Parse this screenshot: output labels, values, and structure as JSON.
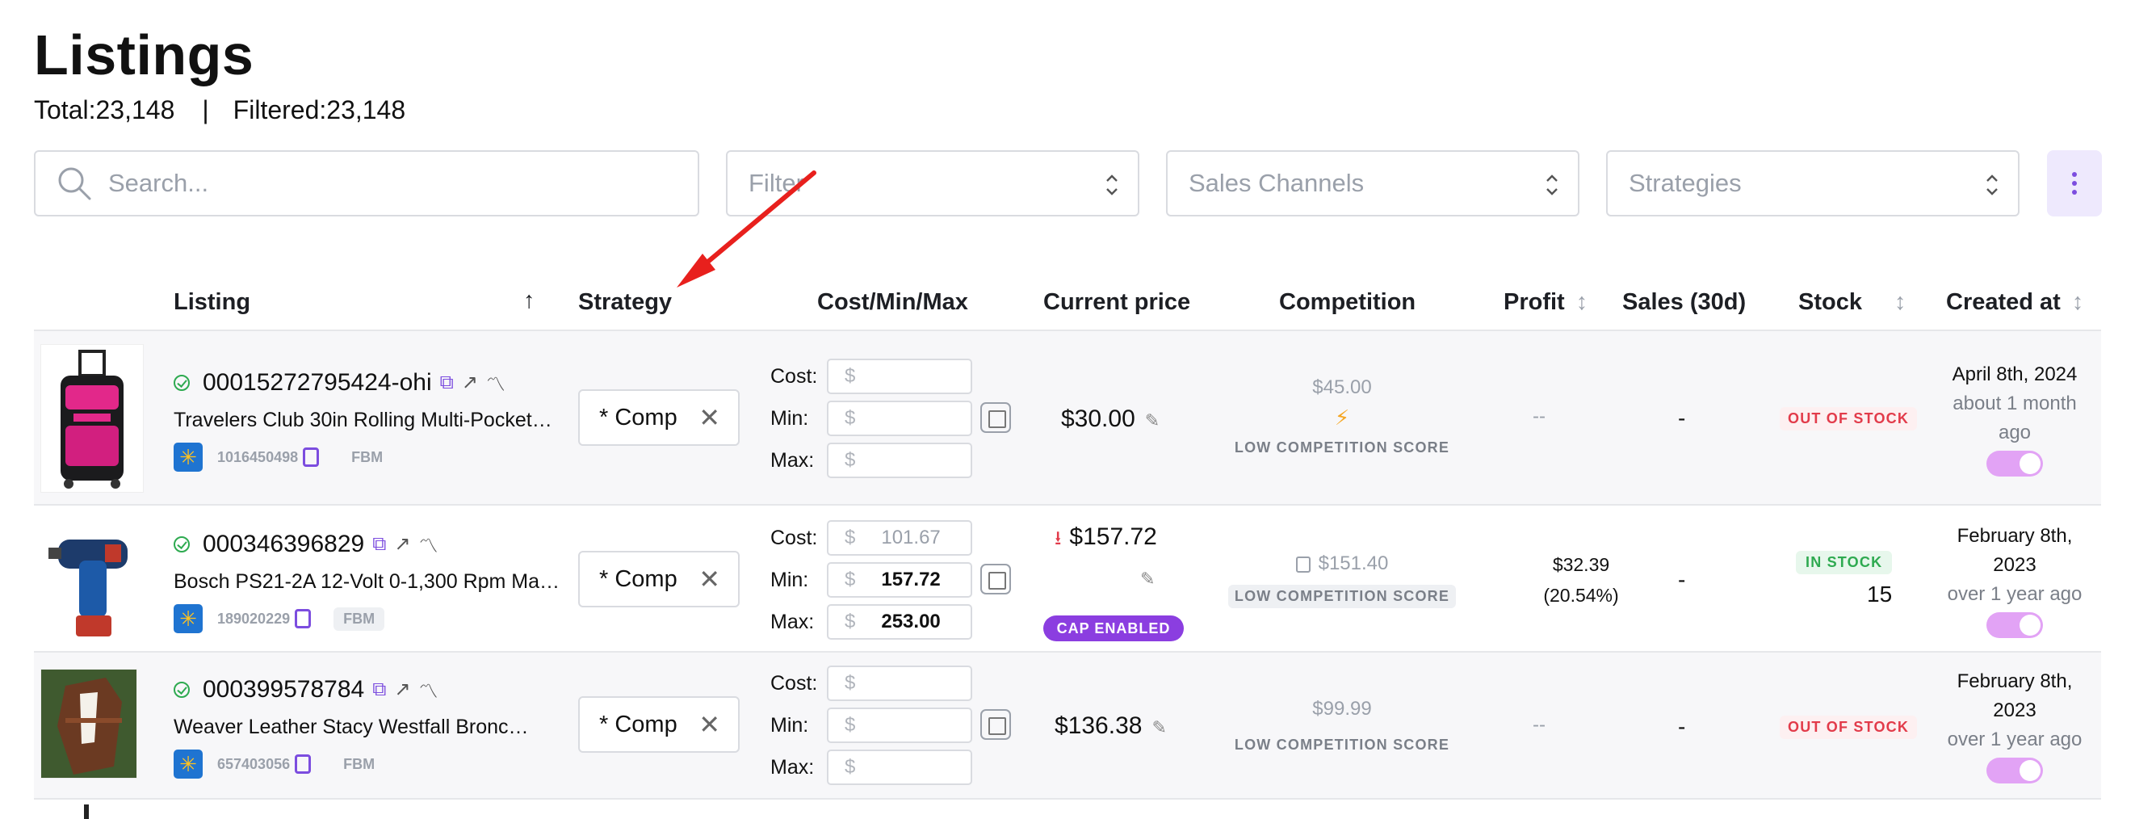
{
  "page": {
    "title": "Listings",
    "total": "Total:23,148",
    "separator": "|",
    "filtered": "Filtered:23,148"
  },
  "toolbar": {
    "search_placeholder": "Search...",
    "filter_placeholder": "Filter",
    "channels_placeholder": "Sales Channels",
    "strategies_placeholder": "Strategies"
  },
  "columns": {
    "listing": "Listing",
    "strategy": "Strategy",
    "cost_min_max": "Cost/Min/Max",
    "current_price": "Current price",
    "competition": "Competition",
    "profit": "Profit",
    "sales": "Sales (30d)",
    "stock": "Stock",
    "created_at": "Created at"
  },
  "labels": {
    "cost": "Cost:",
    "min": "Min:",
    "max": "Max:",
    "currency": "$",
    "channel_type": "FBM"
  },
  "rows": [
    {
      "sku": "00015272795424-ohi",
      "name": "Travelers Club 30in Rolling Multi-Pocket…",
      "item_id": "1016450498",
      "strategy": "* Comp",
      "cost": "",
      "min": "",
      "max": "",
      "price": "$30.00",
      "competition_price": "$45.00",
      "competition_label": "LOW COMPETITION SCORE",
      "profit": "--",
      "sales": "-",
      "stock_status": "OUT OF STOCK",
      "stock_qty": "",
      "created_date": "April 8th, 2024",
      "created_ago_1": "about 1 month",
      "created_ago_2": "ago"
    },
    {
      "sku": "000346396829",
      "name": "Bosch PS21-2A 12-Volt 0-1,300 Rpm Ma…",
      "item_id": "189020229",
      "strategy": "* Comp",
      "cost": "101.67",
      "min": "157.72",
      "max": "253.00",
      "price": "$157.72",
      "cap_badge": "CAP ENABLED",
      "competition_price": "$151.40",
      "competition_label": "LOW COMPETITION SCORE",
      "profit_value": "$32.39",
      "profit_pct": "(20.54%)",
      "sales": "-",
      "stock_status": "IN STOCK",
      "stock_qty": "15",
      "created_date_1": "February 8th,",
      "created_date_2": "2023",
      "created_ago_1": "over 1 year ago"
    },
    {
      "sku": "000399578784",
      "name": "Weaver Leather Stacy Westfall Bronc…",
      "item_id": "657403056",
      "strategy": "* Comp",
      "cost": "",
      "min": "",
      "max": "",
      "price": "$136.38",
      "competition_price": "$99.99",
      "competition_label": "LOW COMPETITION SCORE",
      "profit": "--",
      "sales": "-",
      "stock_status": "OUT OF STOCK",
      "created_date_1": "February 8th,",
      "created_date_2": "2023",
      "created_ago_1": "over 1 year ago"
    }
  ],
  "colors": {
    "accent": "#7c4ddf",
    "out_of_stock": "#e23b4a",
    "in_stock": "#2eaa50",
    "cap": "#8b3ee0",
    "annotation_arrow": "#e8201d"
  }
}
